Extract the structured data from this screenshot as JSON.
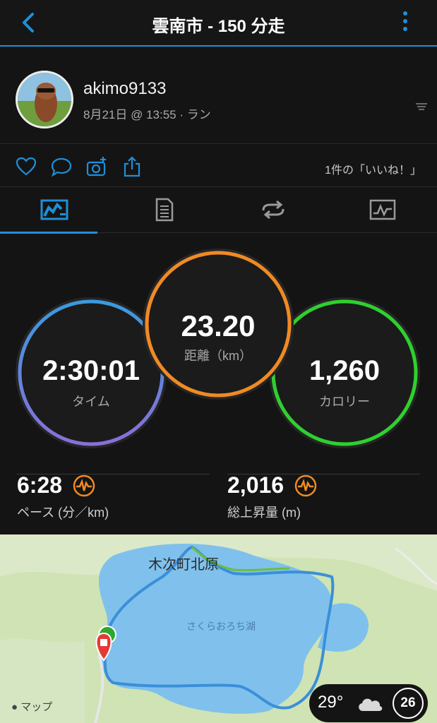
{
  "header": {
    "title": "雲南市 - 150 分走"
  },
  "profile": {
    "username": "akimo9133",
    "subline": "8月21日 @ 13:55 · ラン"
  },
  "actions": {
    "likes_text": "1件の「いいね！」"
  },
  "tabs": [
    "overview-tab",
    "details-tab",
    "laps-tab",
    "charts-tab"
  ],
  "stats": {
    "time": {
      "value": "2:30:01",
      "label": "タイム",
      "color": "#8a6fd8"
    },
    "distance": {
      "value": "23.20",
      "label": "距離（km）",
      "color": "#f08a24"
    },
    "calories": {
      "value": "1,260",
      "label": "カロリー",
      "color": "#2ed12e"
    }
  },
  "metrics": {
    "pace": {
      "value": "6:28",
      "label": "ペース (分／km)"
    },
    "ascent": {
      "value": "2,016",
      "label": "総上昇量 (m)"
    }
  },
  "map": {
    "place_name": "木次町北原",
    "lake_name": "さくらおろち湖",
    "attribution": "マップ"
  },
  "weather": {
    "temperature": "29°",
    "aqi": "26"
  },
  "colors": {
    "accent": "#1f8fd6",
    "route": "#3b8fd8",
    "water": "#7fc1ec"
  }
}
